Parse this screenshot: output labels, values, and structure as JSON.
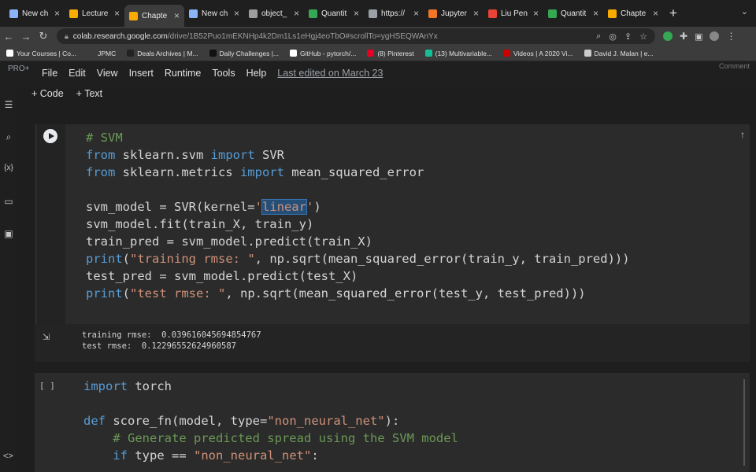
{
  "browser": {
    "tabs": [
      {
        "label": "New ch",
        "color": "#8ab4f8",
        "active": false
      },
      {
        "label": "Lecture",
        "color": "#f9ab00",
        "active": false
      },
      {
        "label": "Chapte",
        "color": "#f9ab00",
        "active": true
      },
      {
        "label": "New ch",
        "color": "#8ab4f8",
        "active": false
      },
      {
        "label": "object_",
        "color": "#9e9e9e",
        "active": false
      },
      {
        "label": "Quantit",
        "color": "#34a853",
        "active": false
      },
      {
        "label": "https://",
        "color": "#9aa0a6",
        "active": false
      },
      {
        "label": "Jupyter",
        "color": "#f37626",
        "active": false
      },
      {
        "label": "Liu Pen",
        "color": "#ea4335",
        "active": false
      },
      {
        "label": "Quantit",
        "color": "#34a853",
        "active": false
      },
      {
        "label": "Chapte",
        "color": "#f9ab00",
        "active": false
      }
    ],
    "new_tab": "+",
    "url_host": "colab.research.google.com",
    "url_path": "/drive/1B52Puo1mEKNHp4k2Dm1Ls1eHgj4eoTbO#scrollTo=ygHSEQWAnYx",
    "bookmarks": [
      {
        "label": "Your Courses | Co...",
        "color": "#ffffff"
      },
      {
        "label": "JPMC",
        "color": "#3c3c3c"
      },
      {
        "label": "Deals Archives | M...",
        "color": "#222222"
      },
      {
        "label": "Daily Challenges |...",
        "color": "#111111"
      },
      {
        "label": "GitHub - pytorch/...",
        "color": "#ffffff"
      },
      {
        "label": "(8) Pinterest",
        "color": "#e60023"
      },
      {
        "label": "(13) Multivariable...",
        "color": "#14bf96"
      },
      {
        "label": "Videos | A 2020 Vi...",
        "color": "#cc0000"
      },
      {
        "label": "David J. Malan | e...",
        "color": "#cccccc"
      }
    ]
  },
  "colab": {
    "pro_label": "PRO+",
    "menu": [
      "File",
      "Edit",
      "View",
      "Insert",
      "Runtime",
      "Tools",
      "Help"
    ],
    "last_edited": "Last edited on March 23",
    "comment_hint": "Comment",
    "add_code": "+ Code",
    "add_text": "+ Text"
  },
  "cell1": {
    "comment": "# SVM",
    "line_from1_kw": "from",
    "line_from1_mod": " sklearn.svm ",
    "line_from1_imp": "import",
    "line_from1_name": " SVR",
    "line_from2_kw": "from",
    "line_from2_mod": " sklearn.metrics ",
    "line_from2_imp": "import",
    "line_from2_name": " mean_squared_error",
    "line_model_pre": "svm_model = SVR(kernel=",
    "line_model_q1": "'",
    "line_model_sel": "linear",
    "line_model_q2": "'",
    "line_model_post": ")",
    "line_fit": "svm_model.fit(train_X, train_y)",
    "line_train_pred": "train_pred = svm_model.predict(train_X)",
    "line_print1_fn": "print",
    "line_print1_open": "(",
    "line_print1_str": "\"training rmse: \"",
    "line_print1_rest": ", np.sqrt(mean_squared_error(train_y, train_pred)))",
    "line_test_pred": "test_pred = svm_model.predict(test_X)",
    "line_print2_fn": "print",
    "line_print2_open": "(",
    "line_print2_str": "\"test rmse: \"",
    "line_print2_rest": ", np.sqrt(mean_squared_error(test_y, test_pred)))"
  },
  "output": {
    "line1": "training rmse:  0.039616045694854767",
    "line2": "test rmse:  0.12296552624960587"
  },
  "cell2": {
    "bracket": "[ ]",
    "import_kw": "import",
    "import_name": " torch",
    "def_kw": "def",
    "def_name": " score_fn",
    "def_args_pre": "(model, type=",
    "def_args_str": "\"non_neural_net\"",
    "def_args_post": "):",
    "comment": "    # Generate predicted spread using the SVM model",
    "if_kw": "    if",
    "if_rest": " type == ",
    "if_str": "\"non_neural_net\"",
    "if_colon": ":"
  }
}
